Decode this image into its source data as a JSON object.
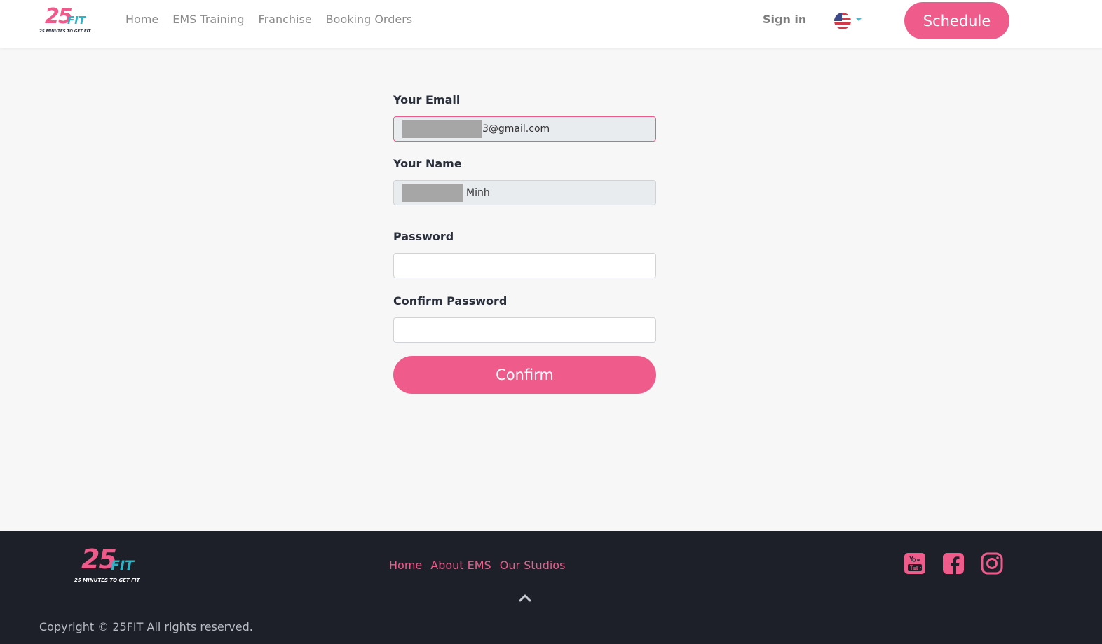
{
  "header": {
    "logo": {
      "number": "25",
      "word": "FIT",
      "tagline": "25 MINUTES TO GET FIT"
    },
    "nav": [
      {
        "label": "Home"
      },
      {
        "label": "EMS Training"
      },
      {
        "label": "Franchise"
      },
      {
        "label": "Booking Orders"
      }
    ],
    "signin_label": "Sign in",
    "language_icon": "us-flag-icon",
    "schedule_label": "Schedule"
  },
  "form": {
    "email_label": "Your Email",
    "email_value": "3@gmail.com",
    "name_label": "Your Name",
    "name_value": "Minh",
    "password_label": "Password",
    "password_value": "",
    "confirm_password_label": "Confirm Password",
    "confirm_password_value": "",
    "confirm_label": "Confirm"
  },
  "footer": {
    "logo": {
      "number": "25",
      "word": "FIT",
      "tagline": "25 MINUTES TO GET FIT"
    },
    "links": [
      {
        "label": "Home"
      },
      {
        "label": "About EMS"
      },
      {
        "label": "Our Studios"
      }
    ],
    "social_icons": [
      "youtube-icon",
      "facebook-icon",
      "instagram-icon"
    ],
    "copyright": "Copyright © 25FIT All rights reserved."
  },
  "colors": {
    "accent": "#ef5b8a",
    "teal": "#2bb5c8",
    "footer_bg": "#1d2029"
  }
}
